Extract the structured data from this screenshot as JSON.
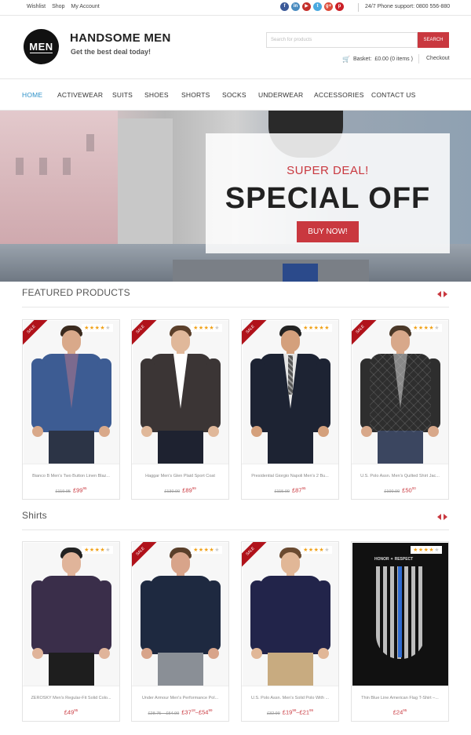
{
  "topbar": {
    "links": [
      "Wishlist",
      "Shop",
      "My Account"
    ],
    "social": [
      {
        "name": "facebook-icon",
        "label": "f",
        "color": "#3b5998"
      },
      {
        "name": "linkedin-icon",
        "label": "in",
        "color": "#4a8cc0"
      },
      {
        "name": "youtube-icon",
        "label": "▶",
        "color": "#c4302b"
      },
      {
        "name": "twitter-icon",
        "label": "t",
        "color": "#4aa9e0"
      },
      {
        "name": "googleplus-icon",
        "label": "g+",
        "color": "#dd4b39"
      },
      {
        "name": "pinterest-icon",
        "label": "p",
        "color": "#cb2027"
      }
    ],
    "phone": "24/7 Phone support: 0800 556-880"
  },
  "header": {
    "logo_text": "MEN",
    "brand_name": "HANDSOME MEN",
    "tagline": "Get the best deal today!",
    "search_placeholder": "Search for products",
    "search_button": "SEARCH",
    "basket_label": "Basket:",
    "basket_value": "£0.00 (0 items )",
    "checkout": "Checkout"
  },
  "nav": {
    "items": [
      "HOME",
      "ACTIVEWEAR",
      "SUITS",
      "SHOES",
      "SHORTS",
      "SOCKS",
      "UNDERWEAR",
      "ACCESSORIES",
      "CONTACT US"
    ],
    "active": "HOME"
  },
  "hero": {
    "super_deal": "SUPER DEAL!",
    "headline": "SPECIAL OFF",
    "button": "BUY NOW!"
  },
  "featured": {
    "title": "FEATURED PRODUCTS",
    "products": [
      {
        "name": "Bianco B Men's Two Button Linen Blaz...",
        "old_price": "£119.95",
        "price": "£99",
        "price_pence": "95",
        "sale_label": "SALE",
        "rating": 4
      },
      {
        "name": "Haggar Men's Glen Plaid Sport Coat",
        "old_price": "£130.00",
        "price": "£89",
        "price_pence": "99",
        "sale_label": "SALE",
        "rating": 4
      },
      {
        "name": "Presidential Giorgio Napoli Men's 2 Bu...",
        "old_price": "£115.00",
        "price": "£87",
        "price_pence": "95",
        "sale_label": "SALE",
        "rating": 5
      },
      {
        "name": "U.S. Polo Assn. Men's Quilted Shirt Jac...",
        "old_price": "£100.00",
        "price": "£50",
        "price_pence": "00",
        "sale_label": "SALE",
        "rating": 4
      }
    ]
  },
  "shirts": {
    "title": "Shirts",
    "products": [
      {
        "name": "ZEROSKY Men's Regular-Fit Solid Colo...",
        "price_text": "£49",
        "price_pence": "95",
        "rating": 4
      },
      {
        "name": "Under Armour Men's Performance Pol...",
        "old_price": "£28.75 – £54.99",
        "price_text": "£37",
        "price_pence": "18",
        "price_to": "–£54",
        "price_to_pence": "99",
        "sale_label": "SALE",
        "rating": 4
      },
      {
        "name": "U.S. Polo Assn. Men's Solid Polo With ...",
        "old_price": "£32.99",
        "price_text": "£19",
        "price_pence": "99",
        "price_to": "–£21",
        "price_to_pence": "99",
        "sale_label": "SALE",
        "rating": 4
      },
      {
        "name": "Thin Blue Line American Flag T-Shirt –...",
        "price_text": "£24",
        "price_pence": "95",
        "rating": 4,
        "print_text": "HONOR ✦ RESPECT"
      }
    ]
  }
}
